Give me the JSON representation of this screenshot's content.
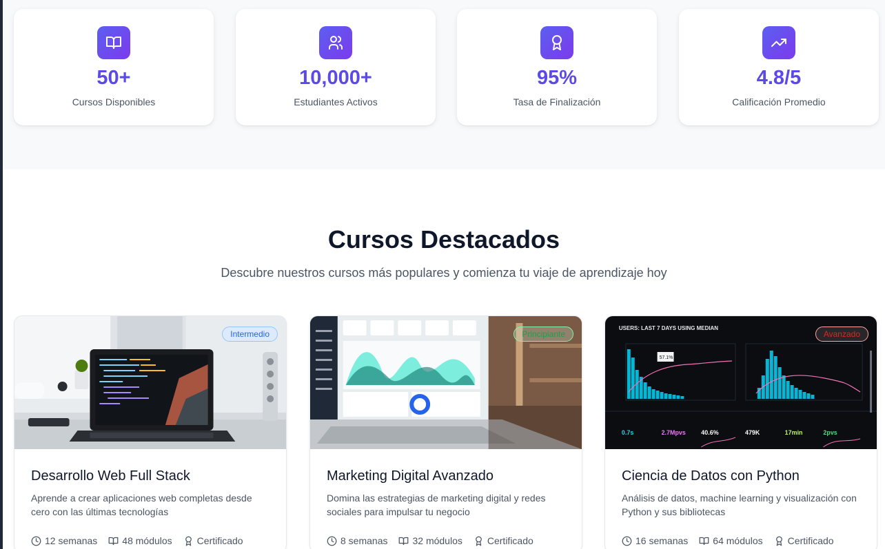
{
  "stats": [
    {
      "icon": "book-open-icon",
      "value": "50+",
      "label": "Cursos Disponibles"
    },
    {
      "icon": "users-icon",
      "value": "10,000+",
      "label": "Estudiantes Activos"
    },
    {
      "icon": "award-icon",
      "value": "95%",
      "label": "Tasa de Finalización"
    },
    {
      "icon": "trending-up-icon",
      "value": "4.8/5",
      "label": "Calificación Promedio"
    }
  ],
  "featured": {
    "title": "Cursos Destacados",
    "subtitle": "Descubre nuestros cursos más populares y comienza tu viaje de aprendizaje hoy"
  },
  "courses": [
    {
      "title": "Desarrollo Web Full Stack",
      "description": "Aprende a crear aplicaciones web completas desde cero con las últimas tecnologías",
      "level": "Intermedio",
      "duration": "12 semanas",
      "modules": "48 módulos",
      "certificate": "Certificado"
    },
    {
      "title": "Marketing Digital Avanzado",
      "description": "Domina las estrategias de marketing digital y redes sociales para impulsar tu negocio",
      "level": "Principiante",
      "duration": "8 semanas",
      "modules": "32 módulos",
      "certificate": "Certificado"
    },
    {
      "title": "Ciencia de Datos con Python",
      "description": "Análisis de datos, machine learning y visualización con Python y sus bibliotecas",
      "level": "Avanzado",
      "duration": "16 semanas",
      "modules": "64 módulos",
      "certificate": "Certificado",
      "image_text": {
        "header": "USERS: LAST 7 DAYS USING MEDIAN",
        "callout": "57.1%",
        "kpis": [
          {
            "value": "0.7s"
          },
          {
            "value": "2.7Mpvs"
          },
          {
            "value": "40.6%"
          },
          {
            "value": "479K"
          },
          {
            "value": "17min"
          },
          {
            "value": "2pvs"
          }
        ]
      }
    }
  ],
  "colors": {
    "accent": "#5b4ae6",
    "icon_gradient_start": "#5b5ff0",
    "icon_gradient_end": "#7c3aed"
  }
}
